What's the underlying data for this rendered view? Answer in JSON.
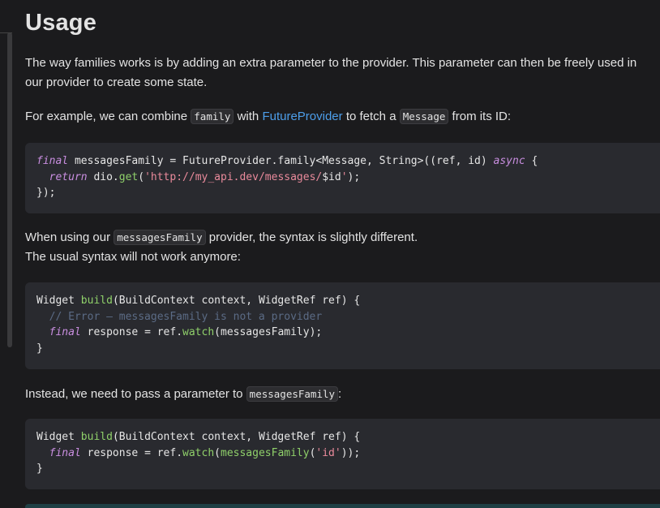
{
  "heading": "Usage",
  "p1": "The way families works is by adding an extra parameter to the provider. This parameter can then be freely used in our provider to create some state.",
  "p2": {
    "t1": "For example, we can combine ",
    "c1": "family",
    "t2": " with ",
    "link": "FutureProvider",
    "t3": " to fetch a ",
    "c2": "Message",
    "t4": " from its ID:"
  },
  "code1": {
    "l1a": "final",
    "l1b": " messagesFamily = FutureProvider.family<Message, String>((ref, id) ",
    "l1c": "async",
    "l1d": " {",
    "l2a": "  ",
    "l2b": "return",
    "l2c": " dio.",
    "l2d": "get",
    "l2e": "(",
    "l2f": "'http://my_api.dev/messages/",
    "l2g": "$id",
    "l2h": "'",
    "l2i": ");",
    "l3": "});"
  },
  "p3": {
    "t1": "When using our ",
    "c1": "messagesFamily",
    "t2": " provider, the syntax is slightly different.",
    "line2": "The usual syntax will not work anymore:"
  },
  "code2": {
    "l1a": "Widget ",
    "l1b": "build",
    "l1c": "(BuildContext context, WidgetRef ref) {",
    "l2": "  // Error – messagesFamily is not a provider",
    "l3a": "  ",
    "l3b": "final",
    "l3c": " response = ref.",
    "l3d": "watch",
    "l3e": "(messagesFamily);",
    "l4": "}"
  },
  "p4": {
    "t1": "Instead, we need to pass a parameter to ",
    "c1": "messagesFamily",
    "t2": ":"
  },
  "code3": {
    "l1a": "Widget ",
    "l1b": "build",
    "l1c": "(BuildContext context, WidgetRef ref) {",
    "l2a": "  ",
    "l2b": "final",
    "l2c": " response = ref.",
    "l2d": "watch",
    "l2e": "(",
    "l2f": "messagesFamily",
    "l2g": "(",
    "l2h": "'id'",
    "l2i": "));",
    "l3": "}"
  }
}
